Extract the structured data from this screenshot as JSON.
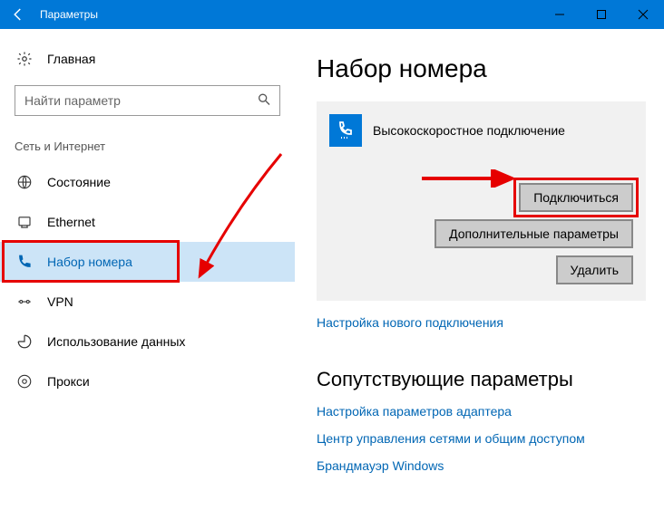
{
  "window": {
    "title": "Параметры"
  },
  "sidebar": {
    "home": "Главная",
    "search_placeholder": "Найти параметр",
    "section": "Сеть и Интернет",
    "items": [
      {
        "label": "Состояние"
      },
      {
        "label": "Ethernet"
      },
      {
        "label": "Набор номера"
      },
      {
        "label": "VPN"
      },
      {
        "label": "Использование данных"
      },
      {
        "label": "Прокси"
      }
    ]
  },
  "main": {
    "heading": "Набор номера",
    "connection_name": "Высокоскоростное подключение",
    "connect_btn": "Подключиться",
    "advanced_btn": "Дополнительные параметры",
    "delete_btn": "Удалить",
    "new_conn_link": "Настройка нового подключения",
    "related_heading": "Сопутствующие параметры",
    "links": [
      "Настройка параметров адаптера",
      "Центр управления сетями и общим доступом",
      "Брандмауэр Windows"
    ]
  }
}
